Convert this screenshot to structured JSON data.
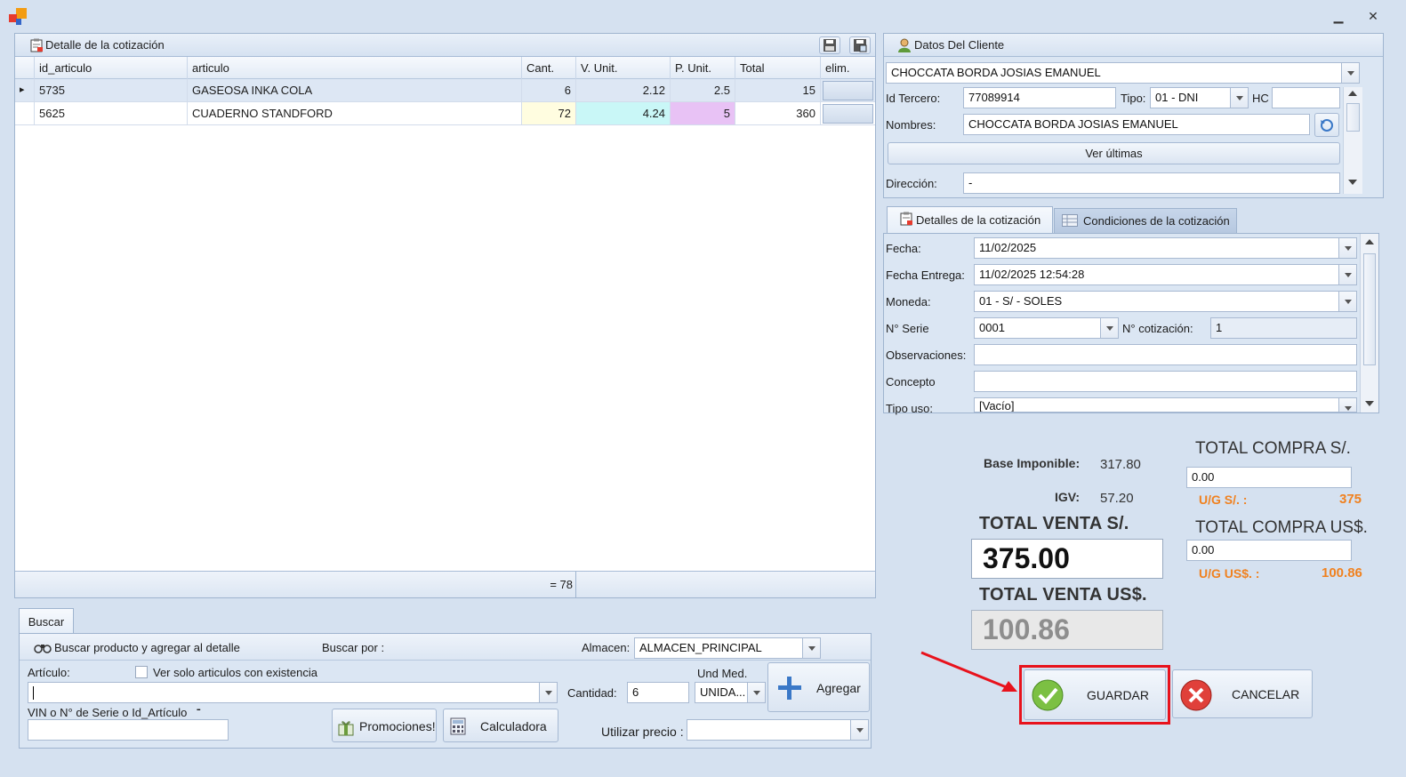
{
  "window": {
    "minimize_glyph": "▁",
    "close_glyph": "✕"
  },
  "detail": {
    "title": "Detalle de la cotización",
    "columns": [
      "id_articulo",
      "articulo",
      "Cant.",
      "V. Unit.",
      "P. Unit.",
      "Total",
      "elim."
    ],
    "rows": [
      {
        "id": "5735",
        "articulo": "GASEOSA INKA COLA",
        "cant": "6",
        "vunit": "2.12",
        "punit": "2.5",
        "total": "15"
      },
      {
        "id": "5625",
        "articulo": "CUADERNO STANDFORD",
        "cant": "72",
        "vunit": "4.24",
        "punit": "5",
        "total": "360"
      }
    ],
    "footer_sum": "= 78",
    "row_indicator": "▸"
  },
  "search": {
    "tab_label": "Buscar",
    "header_label": "Buscar producto y agregar al detalle",
    "buscar_por_label": "Buscar por :",
    "almacen_label": "Almacen:",
    "almacen_value": "ALMACEN_PRINCIPAL",
    "articulo_label": "Artículo:",
    "existencia_label": "Ver solo articulos con existencia",
    "articulo_value": "",
    "cantidad_label": "Cantidad:",
    "cantidad_value": "6",
    "und_med_label": "Und Med.",
    "und_med_value": "UNIDA...",
    "agregar_label": "Agregar",
    "vin_label": "VIN o N° de Serie o Id_Artículo",
    "vin_value": "",
    "promociones_label": "Promociones!",
    "calculadora_label": "Calculadora",
    "utilizar_precio_label": "Utilizar precio :",
    "utilizar_precio_value": ""
  },
  "cliente": {
    "title": "Datos Del Cliente",
    "selected": "CHOCCATA BORDA JOSIAS EMANUEL",
    "id_tercero_label": "Id Tercero:",
    "id_tercero_value": "77089914",
    "tipo_label": "Tipo:",
    "tipo_value": "01 - DNI",
    "hc_label": "HC",
    "hc_value": "",
    "nombres_label": "Nombres:",
    "nombres_value": "CHOCCATA BORDA JOSIAS EMANUEL",
    "ver_ultimas_label": "Ver últimas",
    "direccion_label": "Dirección:",
    "direccion_value": "-"
  },
  "cotizacion": {
    "tab_detalles": "Detalles de la cotización",
    "tab_condiciones": "Condiciones de la cotización",
    "fecha_label": "Fecha:",
    "fecha_value": "11/02/2025",
    "fecha_entrega_label": "Fecha Entrega:",
    "fecha_entrega_value": "11/02/2025 12:54:28",
    "moneda_label": "Moneda:",
    "moneda_value": "01 - S/  - SOLES",
    "serie_label": "N° Serie",
    "serie_value": "0001",
    "num_cot_label": "N° cotización:",
    "num_cot_value": "1",
    "observaciones_label": "Observaciones:",
    "observaciones_value": "",
    "concepto_label": "Concepto",
    "concepto_value": "",
    "tipo_uso_label": "Tipo uso:",
    "tipo_uso_value": "[Vacío]"
  },
  "totals": {
    "base_label": "Base Imponible:",
    "base_value": "317.80",
    "igv_label": "IGV:",
    "igv_value": "57.20",
    "total_venta_sol_label": "TOTAL VENTA S/.",
    "total_venta_sol_value": "375.00",
    "total_venta_usd_label": "TOTAL VENTA US$.",
    "total_venta_usd_value": "100.86",
    "total_compra_sol_label": "TOTAL COMPRA S/.",
    "total_compra_sol_value": "0.00",
    "ug_sol_label": "U/G S/. :",
    "ug_sol_value": "375",
    "total_compra_usd_label": "TOTAL COMPRA US$.",
    "total_compra_usd_value": "0.00",
    "ug_usd_label": "U/G US$. :",
    "ug_usd_value": "100.86"
  },
  "actions": {
    "guardar_label": "GUARDAR",
    "cancelar_label": "CANCELAR"
  },
  "colors": {
    "cant_bg": "#fffde0",
    "vunit_bg": "#c9f7f7",
    "punit_bg": "#e8c2f5",
    "highlight": "#e8121c",
    "accent_orange": "#f0811f"
  }
}
